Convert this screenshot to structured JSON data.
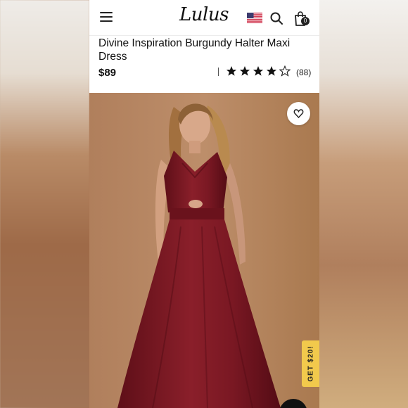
{
  "header": {
    "logo_text": "Lulus",
    "flag_icon": "us-flag-icon",
    "search_icon": "search-icon",
    "bag_icon": "shopping-bag-icon",
    "bag_count": "0"
  },
  "product": {
    "title": "Divine Inspiration Burgundy Halter Maxi Dress",
    "price": "$89",
    "rating": {
      "stars_filled": 4,
      "stars_total": 5,
      "count": "(88)"
    },
    "image": {
      "description_icon": "burgundy-maxi-dress-photo",
      "wishlist_icon": "heart-icon"
    }
  },
  "promo": {
    "label": "GET $20!"
  },
  "colors": {
    "dress": "#7a1a22",
    "background": "#b58562",
    "promo": "#f2c94c"
  }
}
